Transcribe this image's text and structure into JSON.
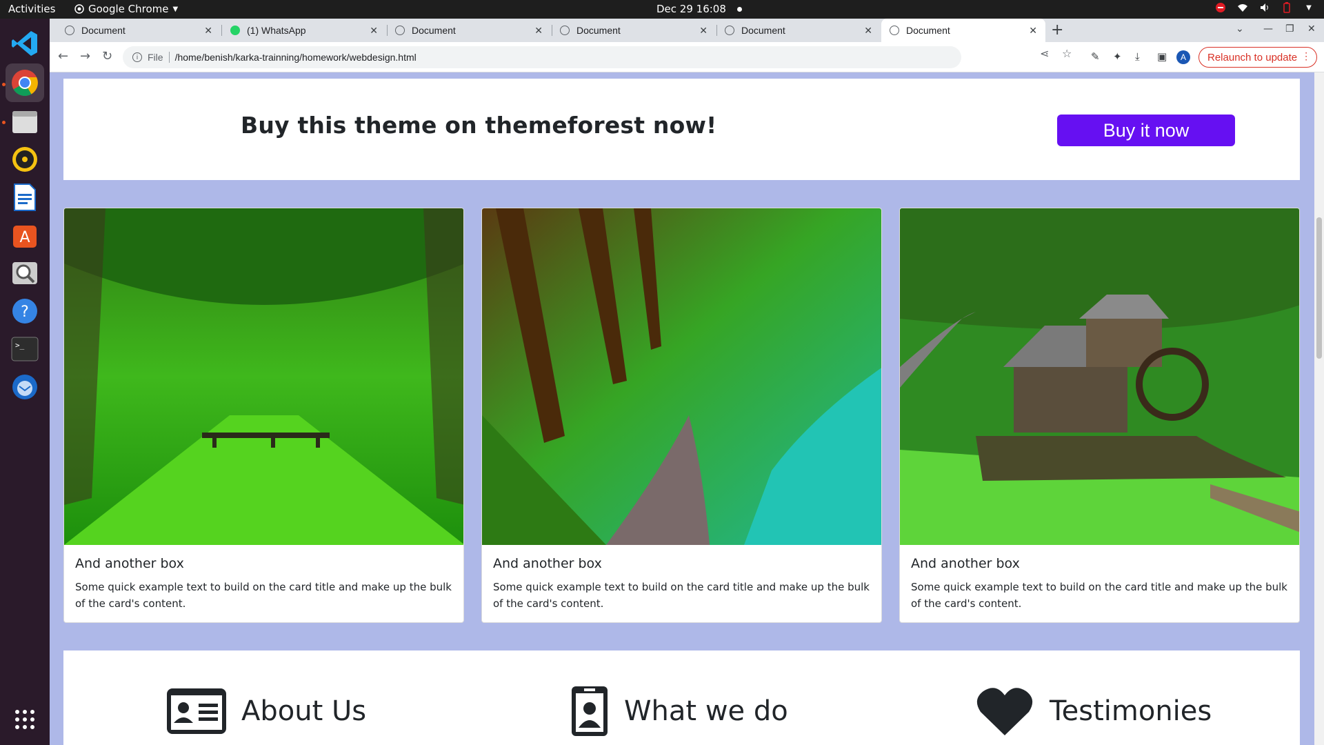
{
  "os": {
    "activities": "Activities",
    "app_name": "Google Chrome",
    "clock": "Dec 29  16:08"
  },
  "dock": {
    "items": [
      "vscode-icon",
      "chrome-icon",
      "files-icon",
      "rhythmbox-icon",
      "writer-icon",
      "software-icon",
      "screenshot-icon",
      "help-icon",
      "terminal-icon",
      "thunderbird-icon",
      "app-grid-icon"
    ]
  },
  "browser": {
    "tabs": [
      {
        "title": "Document",
        "active": false
      },
      {
        "title": "(1) WhatsApp",
        "active": false
      },
      {
        "title": "Document",
        "active": false
      },
      {
        "title": "Document",
        "active": false
      },
      {
        "title": "Document",
        "active": false
      },
      {
        "title": "Document",
        "active": true
      }
    ],
    "url_scheme": "File",
    "url": "/home/benish/karka-trainning/homework/webdesign.html",
    "avatar_initial": "A",
    "relaunch_label": "Relaunch to update"
  },
  "page": {
    "banner": {
      "heading": "Buy this theme on themeforest now!",
      "button": "Buy it now"
    },
    "cards": [
      {
        "title": "And another box",
        "text": "Some quick example text to build on the card title and make up the bulk of the card's content.",
        "image": "green-tree-tunnel-with-bench"
      },
      {
        "title": "And another box",
        "text": "Some quick example text to build on the card title and make up the bulk of the card's content.",
        "image": "forest-path-by-river"
      },
      {
        "title": "And another box",
        "text": "Some quick example text to build on the card title and make up the bulk of the card's content.",
        "image": "mill-house-by-pond"
      }
    ],
    "features": [
      {
        "title": "About Us",
        "icon": "id-card-icon"
      },
      {
        "title": "What we do",
        "icon": "id-badge-icon"
      },
      {
        "title": "Testimonies",
        "icon": "heart-icon"
      }
    ]
  },
  "colors": {
    "page_bg": "#aeb8e8",
    "primary_button": "#6610f2",
    "relaunch": "#d93025"
  }
}
